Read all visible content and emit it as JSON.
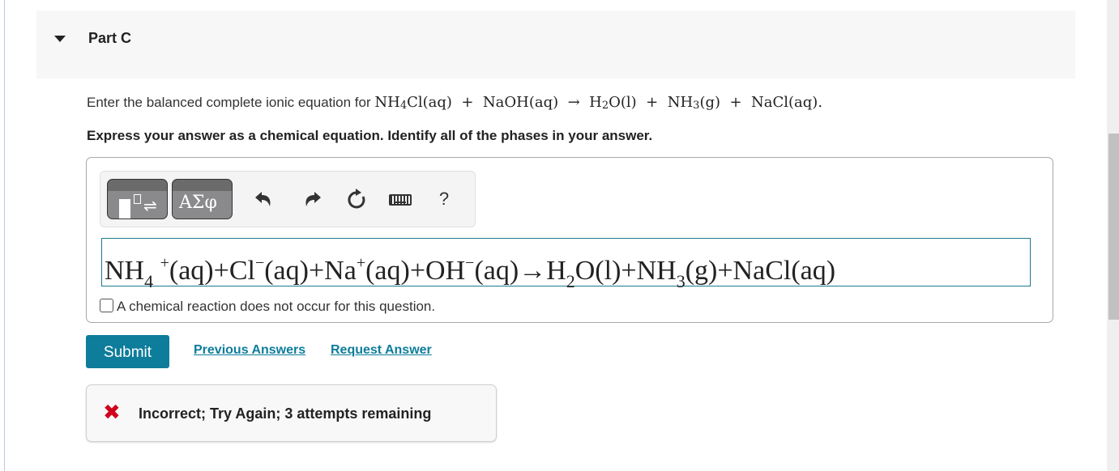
{
  "part": {
    "title": "Part C",
    "expanded": true
  },
  "prompt": {
    "lead": "Enter the balanced complete ionic equation for",
    "reaction": {
      "reactant1": "NH",
      "reactant1_sub": "4",
      "reactant1_rest": "Cl(aq)",
      "plus1": "+",
      "reactant2": "NaOH(aq)",
      "arrow": "→",
      "product1": "H",
      "product1_sub": "2",
      "product1_rest": "O(l)",
      "plus2": "+",
      "product2": "NH",
      "product2_sub": "3",
      "product2_rest": "(g)",
      "plus3": "+",
      "product3": "NaCl(aq).",
      "sep": " "
    },
    "instruction": "Express your answer as a chemical equation. Identify all of the phases in your answer."
  },
  "toolbar": {
    "templates_label": "templates",
    "symbols_glyphs": "ΑΣφ",
    "arrows_glyph": "⇌",
    "undo_glyph": "↶",
    "redo_glyph": "↷",
    "reset_glyph": "↻",
    "help_glyph": "?"
  },
  "answer": {
    "terms": [
      {
        "t": "NH",
        "sub": "4",
        "sup": "+",
        "phase": "(aq)"
      },
      {
        "t": "+"
      },
      {
        "t": "Cl",
        "sup": "−",
        "phase": "(aq)"
      },
      {
        "t": "+"
      },
      {
        "t": "Na",
        "sup": "+",
        "phase": "(aq)"
      },
      {
        "t": "+"
      },
      {
        "t": "OH",
        "sup": "−",
        "phase": "(aq)"
      },
      {
        "t": "→"
      },
      {
        "t": "H",
        "sub": "2",
        "phase": "O(l)"
      },
      {
        "t": "+"
      },
      {
        "t": "NH",
        "sub": "3",
        "phase": "(g)"
      },
      {
        "t": "+"
      },
      {
        "t": "NaCl(aq)"
      }
    ],
    "no_reaction_label": "A chemical reaction does not occur for this question.",
    "no_reaction_checked": false
  },
  "actions": {
    "submit": "Submit",
    "previous_answers": "Previous Answers",
    "request_answer": "Request Answer"
  },
  "feedback": {
    "icon": "✖",
    "message": "Incorrect; Try Again; 3 attempts remaining",
    "status_color": "#d0021b"
  },
  "colors": {
    "accent": "#0e7c9b",
    "header_bg": "#f7f7f7"
  }
}
